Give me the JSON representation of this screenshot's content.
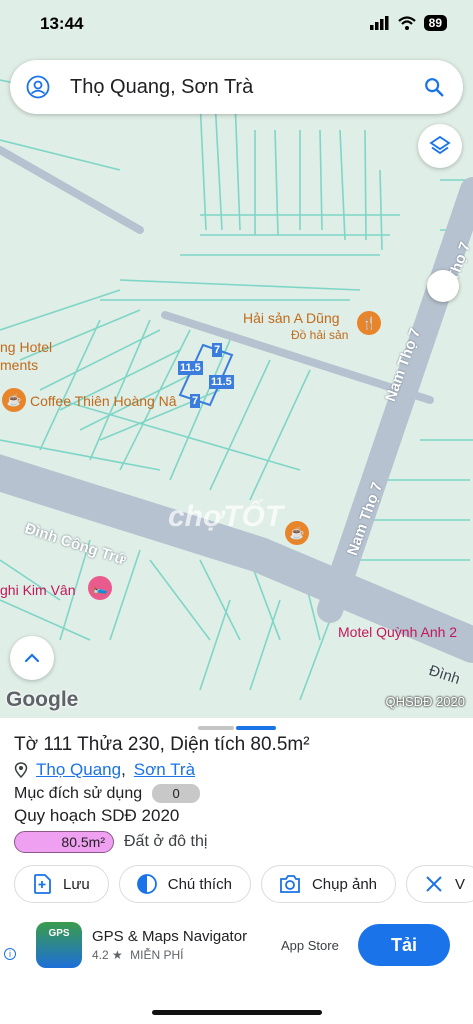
{
  "status_bar": {
    "time": "13:44",
    "battery": "89"
  },
  "search": {
    "query": "Thọ Quang, Sơn Trà"
  },
  "map": {
    "pois": [
      {
        "name": "Hải sản A Dũng",
        "category": "Đồ hải sản"
      },
      {
        "name": "Coffee Thiên Hoàng Nâ"
      },
      {
        "name_part1": "ng Hotel",
        "name_part2": "ments"
      },
      {
        "name": "ghi Kim Vân"
      },
      {
        "name": "Motel Quỳnh Anh 2"
      }
    ],
    "roads": {
      "nam_tho_7_a": "Nam Thọ 7",
      "nam_tho_7_b": "Nam Thọ 7",
      "nam_tho_7_c": "n Thọ 7",
      "dinh_cong_tru": "Đình Công Trứ",
      "dinh_partial": "Đình"
    },
    "plot_edges": [
      "7",
      "11.5",
      "11.5",
      "7"
    ],
    "google": "Google",
    "source": "QHSDĐ 2020",
    "watermark": "chợTỐT"
  },
  "parcel": {
    "title": "Tờ 111 Thửa 230, Diện tích 80.5m²",
    "ward": "Thọ Quang",
    "district": "Sơn Trà",
    "purpose_label": "Mục đích sử dụng",
    "purpose_value": "0",
    "plan_title": "Quy hoạch SDĐ 2020",
    "plan_area": "80.5m²",
    "plan_type": "Đất ở đô thị",
    "colors": {
      "plan_chip": "#f0a0f0",
      "link": "#1a73e8"
    }
  },
  "actions": [
    {
      "label": "Lưu",
      "icon": "add-box-icon"
    },
    {
      "label": "Chú thích",
      "icon": "legend-icon"
    },
    {
      "label": "Chụp ảnh",
      "icon": "camera-icon"
    },
    {
      "label": "V",
      "icon": "measure-icon"
    }
  ],
  "ad": {
    "app_name": "GPS & Maps Navigator",
    "icon_text": "GPS",
    "rating": "4.2 ★",
    "price": "MIỄN PHÍ",
    "store": "App Store",
    "cta": "Tải"
  }
}
